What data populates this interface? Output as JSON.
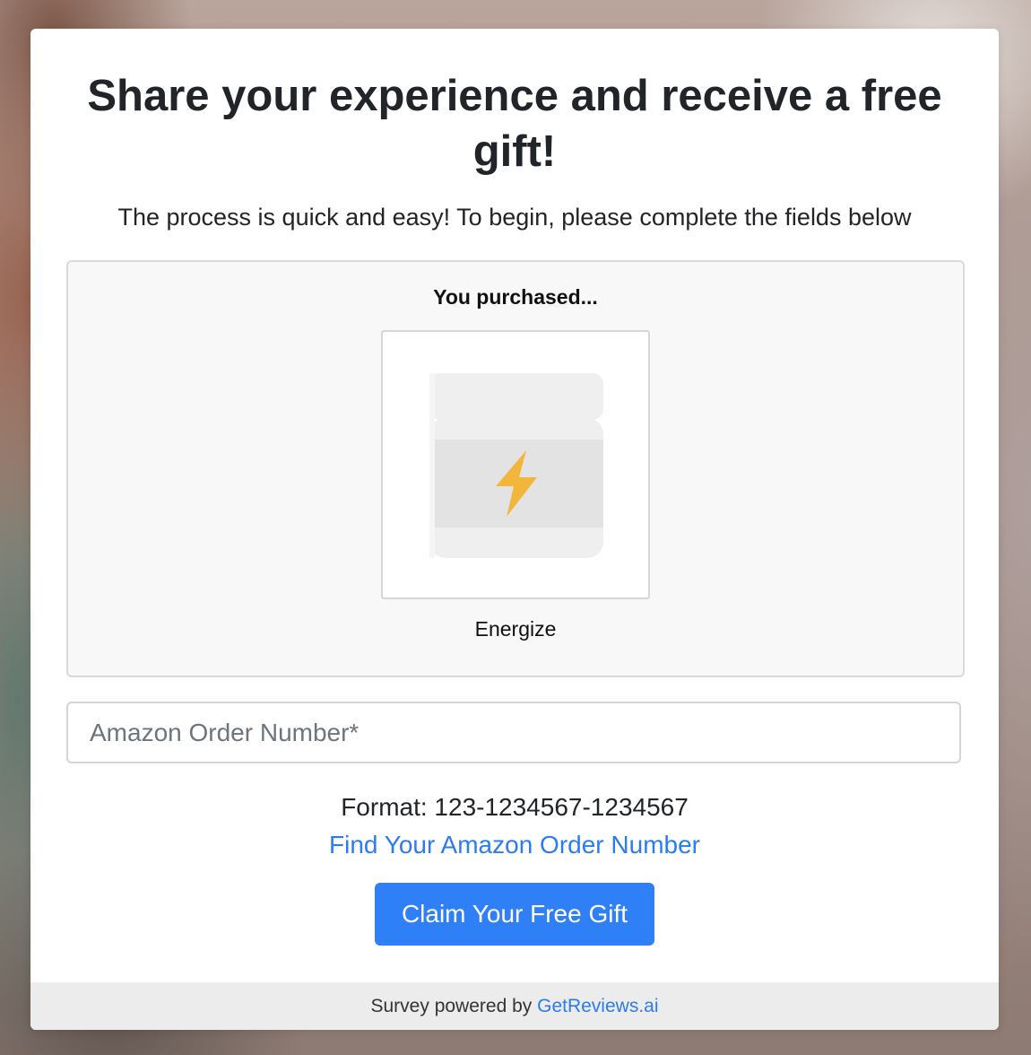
{
  "background": {
    "type": "photo-blur"
  },
  "card": {
    "title": "Share your experience and receive a free gift!",
    "subtitle": "The process is quick and easy! To begin, please complete the fields below"
  },
  "product": {
    "purchased_label": "You purchased...",
    "name": "Energize",
    "icon": "lightning-bolt-icon",
    "icon_color": "#F2B63A"
  },
  "form": {
    "order_placeholder": "Amazon Order Number*",
    "order_value": "",
    "format_hint": "Format: 123-1234567-1234567",
    "help_link": "Find Your Amazon Order Number",
    "submit_label": "Claim Your Free Gift"
  },
  "footer": {
    "prefix": "Survey powered by ",
    "brand_link": "GetReviews.ai"
  },
  "colors": {
    "accent": "#2F7FF7",
    "link": "#2B7CF2",
    "panel_bg": "#F8F8F8"
  }
}
